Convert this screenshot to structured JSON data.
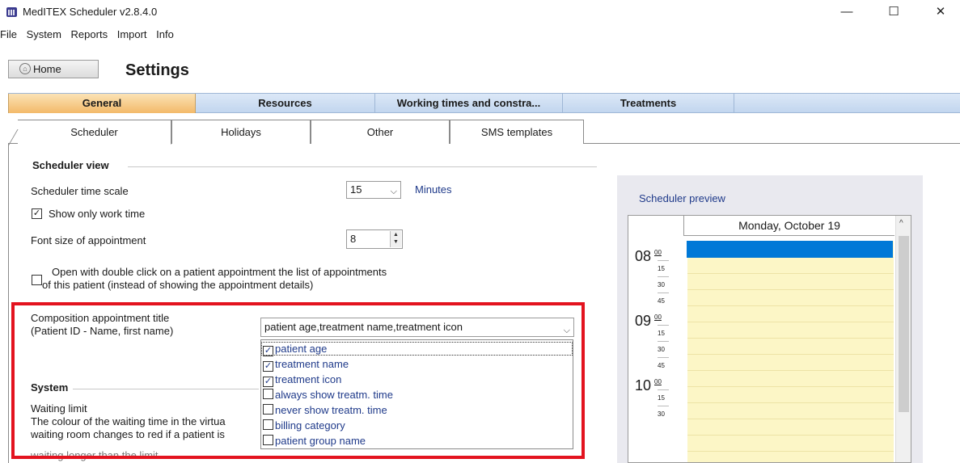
{
  "window": {
    "title": "MedITEX Scheduler  v2.8.4.0",
    "controls": {
      "minimize": "—",
      "maximize": "☐",
      "close": "✕"
    }
  },
  "menu": [
    "File",
    "System",
    "Reports",
    "Import",
    "Info"
  ],
  "toolbar": {
    "home_label": "Home",
    "home_icon": "home-icon"
  },
  "page_title": "Settings",
  "main_tabs": [
    {
      "label": "General",
      "active": true
    },
    {
      "label": "Resources",
      "active": false
    },
    {
      "label": "Working times and constra...",
      "active": false
    },
    {
      "label": "Treatments",
      "active": false
    }
  ],
  "sub_tabs": [
    {
      "label": "Scheduler",
      "active": true
    },
    {
      "label": "Holidays",
      "active": false
    },
    {
      "label": "Other",
      "active": false
    },
    {
      "label": "SMS templates",
      "active": false
    }
  ],
  "scheduler_view": {
    "title": "Scheduler view",
    "time_scale_label": "Scheduler time scale",
    "time_scale_value": "15",
    "time_scale_unit": "Minutes",
    "show_work_time_label": "Show only work time",
    "show_work_time_checked": true,
    "font_size_label": "Font size of appointment",
    "font_size_value": "8",
    "double_click_line1": "Open with double click on a patient appointment the list of appointments",
    "double_click_line2": "of this patient (instead of showing the appointment details)",
    "double_click_checked": false
  },
  "composition": {
    "label_line1": "Composition appointment title",
    "label_line2": "(Patient ID - Name, first name)",
    "selected_value": "patient age,treatment name,treatment icon",
    "options": [
      {
        "label": "patient age",
        "checked": true
      },
      {
        "label": "treatment name",
        "checked": true
      },
      {
        "label": "treatment icon",
        "checked": true
      },
      {
        "label": "always show treatm. time",
        "checked": false
      },
      {
        "label": "never show treatm. time",
        "checked": false
      },
      {
        "label": "billing category",
        "checked": false
      },
      {
        "label": "patient group name",
        "checked": false
      }
    ]
  },
  "system": {
    "title": "System",
    "waiting_limit_label": "Waiting limit",
    "desc_line1": "The colour of the waiting time in the virtua",
    "desc_line2": "waiting room changes to red if a patient is",
    "desc_line3": "waiting longer than the limit"
  },
  "preview": {
    "title": "Scheduler preview",
    "day_header": "Monday, October 19",
    "hours": [
      {
        "hour": "08",
        "quarters": [
          "00",
          "15",
          "30",
          "45"
        ]
      },
      {
        "hour": "09",
        "quarters": [
          "00",
          "15",
          "30",
          "45"
        ]
      },
      {
        "hour": "10",
        "quarters": [
          "00",
          "15",
          "30"
        ]
      }
    ]
  },
  "colors": {
    "highlight": "#e3131f",
    "active_tab": "#f3b969",
    "tab_bar": "#c2d6ef",
    "appointment": "#0078d7",
    "slot_background": "#fcf6c6"
  }
}
